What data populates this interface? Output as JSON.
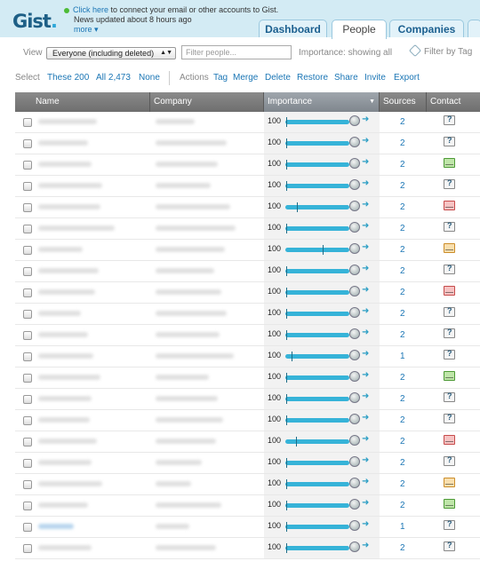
{
  "header": {
    "logo": "Gist",
    "notice_link": "Click here",
    "notice_text": "to connect your email or other accounts to Gist.",
    "news": "News updated about 8 hours ago",
    "more": "more ▾"
  },
  "tabs": [
    {
      "label": "Dashboard"
    },
    {
      "label": "People"
    },
    {
      "label": "Companies"
    }
  ],
  "controls": {
    "view_label": "View",
    "view_value": "Everyone (including deleted)",
    "filter_placeholder": "Filter people...",
    "importance_label": "Importance: showing all",
    "filter_tag": "Filter by Tag"
  },
  "select_bar": {
    "select_label": "Select",
    "these_200": "These 200",
    "all": "All 2,473",
    "none": "None",
    "actions_label": "Actions",
    "tag": "Tag",
    "merge": "Merge",
    "delete": "Delete",
    "restore": "Restore",
    "share": "Share",
    "invite": "Invite",
    "export": "Export"
  },
  "table": {
    "columns": [
      "Name",
      "Company",
      "Importance",
      "Sources",
      "Contact"
    ],
    "rows": [
      {
        "importance": "100",
        "sources": "2",
        "contact": "unknown",
        "marker": 0.02
      },
      {
        "importance": "100",
        "sources": "2",
        "contact": "unknown",
        "marker": 0.02
      },
      {
        "importance": "100",
        "sources": "2",
        "contact": "green",
        "marker": 0.02
      },
      {
        "importance": "100",
        "sources": "2",
        "contact": "unknown",
        "marker": 0.02
      },
      {
        "importance": "100",
        "sources": "2",
        "contact": "red",
        "marker": 0.18
      },
      {
        "importance": "100",
        "sources": "2",
        "contact": "unknown",
        "marker": 0.02
      },
      {
        "importance": "100",
        "sources": "2",
        "contact": "orange",
        "marker": 0.58
      },
      {
        "importance": "100",
        "sources": "2",
        "contact": "unknown",
        "marker": 0.02
      },
      {
        "importance": "100",
        "sources": "2",
        "contact": "red",
        "marker": 0.02
      },
      {
        "importance": "100",
        "sources": "2",
        "contact": "unknown",
        "marker": 0.02
      },
      {
        "importance": "100",
        "sources": "2",
        "contact": "unknown",
        "marker": 0.02
      },
      {
        "importance": "100",
        "sources": "1",
        "contact": "unknown",
        "marker": 0.1
      },
      {
        "importance": "100",
        "sources": "2",
        "contact": "green",
        "marker": 0.02
      },
      {
        "importance": "100",
        "sources": "2",
        "contact": "unknown",
        "marker": 0.02
      },
      {
        "importance": "100",
        "sources": "2",
        "contact": "unknown",
        "marker": 0.02
      },
      {
        "importance": "100",
        "sources": "2",
        "contact": "red",
        "marker": 0.16
      },
      {
        "importance": "100",
        "sources": "2",
        "contact": "unknown",
        "marker": 0.02
      },
      {
        "importance": "100",
        "sources": "2",
        "contact": "orange",
        "marker": 0.02
      },
      {
        "importance": "100",
        "sources": "2",
        "contact": "green",
        "marker": 0.02
      },
      {
        "importance": "100",
        "sources": "1",
        "contact": "unknown",
        "marker": 0.02
      },
      {
        "importance": "100",
        "sources": "2",
        "contact": "unknown",
        "marker": 0.02
      }
    ]
  },
  "colors": {
    "header_bg": "#d3ebf4",
    "link": "#1b76b5",
    "slider": "#36b3d8",
    "table_header": "#7a7a7a"
  }
}
